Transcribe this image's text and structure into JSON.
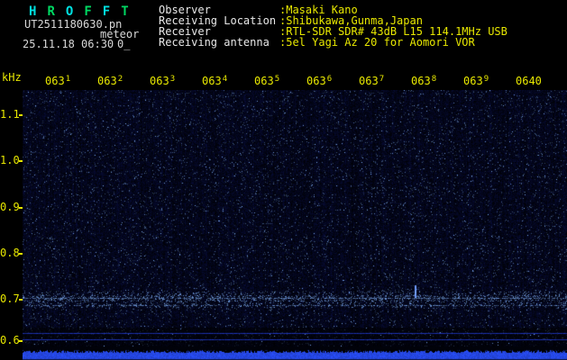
{
  "colors": {
    "background": "#000000",
    "plot_base": "#000210",
    "noise_blue": "#2238ff",
    "bright_dot": "#7fb0ff",
    "axis_text": "#e8e800",
    "header_label": "#e8e8e8",
    "header_value": "#e8e800",
    "file_text": "#d8d8d8",
    "strip_bar": "#2a50ff",
    "line_blue": "#2038c8"
  },
  "app": {
    "logo_letters": [
      {
        "ch": "H",
        "color": "#00e0e0"
      },
      {
        "ch": "R",
        "color": "#00d862"
      },
      {
        "ch": "O",
        "color": "#00e0e0"
      },
      {
        "ch": "F",
        "color": "#00d862"
      },
      {
        "ch": "F",
        "color": "#00e0e0"
      },
      {
        "ch": "T",
        "color": "#00d862"
      }
    ],
    "filename": "UT2511180630.pn",
    "station_note": "meteor",
    "datetime": "25.11.18 06:30",
    "status": "0_"
  },
  "header": {
    "rows": [
      {
        "label": "Observer",
        "value": ":Masaki Kano"
      },
      {
        "label": "Receiving Location",
        "value": ":Shibukawa,Gunma,Japan"
      },
      {
        "label": "Receiver",
        "value": ":RTL-SDR SDR# 43dB L15 114.1MHz USB"
      },
      {
        "label": "Receiving antenna",
        "value": ":5el Yagi Az 20 for Aomori VOR"
      }
    ]
  },
  "chart_data": {
    "type": "heatmap",
    "title": "H R O F F T",
    "xlabel": "",
    "ylabel": "kHz",
    "x_ticks": [
      "0631",
      "0632",
      "0633",
      "0634",
      "0635",
      "0636",
      "0637",
      "0638",
      "0639",
      "0640"
    ],
    "y_ticks": [
      "1.1",
      "1.0",
      "0.9",
      "0.8",
      "0.7",
      "0.6"
    ],
    "ylim": [
      0.58,
      1.16
    ],
    "grid": false,
    "legend": "none",
    "features": [
      {
        "kind": "speckle-band",
        "khz": 0.705,
        "description": "dense blue noise band across full width near 0.7 kHz"
      },
      {
        "kind": "echo-dash",
        "khz": 0.718,
        "x_frac": 0.72,
        "description": "short bright vertical meteor-echo dash near 0638"
      },
      {
        "kind": "line",
        "khz": 0.627,
        "description": "thin horizontal blue line across full width"
      },
      {
        "kind": "line",
        "khz": 0.613,
        "description": "thin horizontal blue line across full width"
      },
      {
        "kind": "power-strip",
        "description": "bright blue signal-level bar along bottom edge"
      }
    ]
  }
}
